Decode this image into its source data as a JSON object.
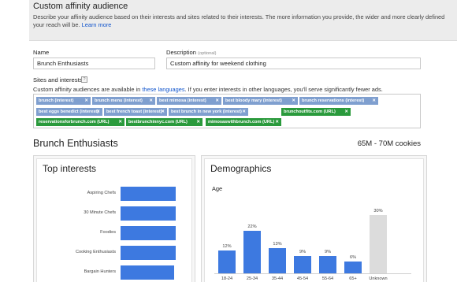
{
  "header": {
    "title": "Custom affinity audience",
    "description": "Describe your affinity audience based on their interests and sites related to their interests. The more information you provide, the wider and more clearly defined your reach will be.",
    "learn_more": "Learn more"
  },
  "form": {
    "name_label": "Name",
    "name_value": "Brunch Enthusiasts",
    "description_label": "Description",
    "description_optional": "(optional)",
    "description_value": "Custom affinity for weekend clothing"
  },
  "sites": {
    "label": "Sites and interests",
    "help_icon": "help-icon",
    "note_prefix": "Custom affinity audiences are available in",
    "note_link": "these languages",
    "note_suffix": ". If you enter interests in other languages, you'll serve significantly fewer ads."
  },
  "tags": [
    {
      "text": "brunch (interest)",
      "kind": "interest"
    },
    {
      "text": "brunch menu (interest)",
      "kind": "interest"
    },
    {
      "text": "best mimosa (interest)",
      "kind": "interest"
    },
    {
      "text": "best bloody mary (interest)",
      "kind": "interest"
    },
    {
      "text": "brunch reservations (interest)",
      "kind": "interest"
    },
    {
      "text": "best eggs benedict (interest)",
      "kind": "interest"
    },
    {
      "text": "best french toast (interest)",
      "kind": "interest"
    },
    {
      "text": "best brunch in new york (interest)",
      "kind": "interest"
    },
    {
      "text": "brunchoutfits.com (URL)",
      "kind": "url"
    },
    {
      "text": "reservationsforbrunch.com (URL)",
      "kind": "url"
    },
    {
      "text": "bestbrunchinnyc.com (URL)",
      "kind": "url"
    },
    {
      "text": "mimosaswithbrunch.com (URL)",
      "kind": "url"
    }
  ],
  "tag_remove_glyph": "✕",
  "audience": {
    "title": "Brunch Enthusiasts",
    "cookies": "65M - 70M cookies"
  },
  "top_interests": {
    "title": "Top interests",
    "items": [
      "Aspiring Chefs",
      "30 Minute Chefs",
      "Foodies",
      "Cooking Enthusiasts",
      "Bargain Hunters"
    ],
    "bar_fractions": [
      1.0,
      1.0,
      1.0,
      1.0,
      0.97
    ],
    "bar_color": "#3d79e0"
  },
  "demographics": {
    "title": "Demographics",
    "age_label": "Age",
    "chart_data": {
      "type": "bar",
      "categories": [
        "18-24",
        "25-34",
        "35-44",
        "45-54",
        "55-64",
        "65+",
        "Unknown"
      ],
      "values": [
        12,
        22,
        13,
        9,
        9,
        6,
        30
      ],
      "data_labels": [
        "12%",
        "22%",
        "13%",
        "9%",
        "9%",
        "6%",
        "30%"
      ],
      "colors": [
        "#3d79e0",
        "#3d79e0",
        "#3d79e0",
        "#3d79e0",
        "#3d79e0",
        "#3d79e0",
        "#dcdcdc"
      ]
    }
  }
}
